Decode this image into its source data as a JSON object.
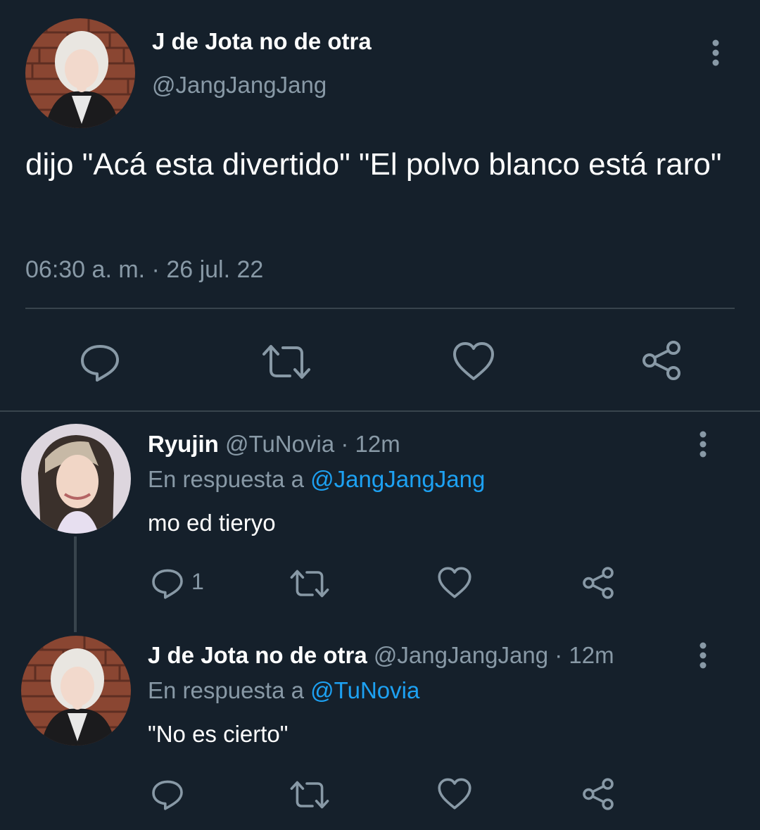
{
  "main_tweet": {
    "display_name": "J de Jota no de otra",
    "handle": "@JangJangJang",
    "text": "dijo \"Acá esta divertido\" \"El polvo blanco está raro\"",
    "timestamp": "06:30 a. m. · 26 jul. 22",
    "more_icon": "more-vertical-icon",
    "actions": [
      "reply-icon",
      "retweet-icon",
      "like-icon",
      "share-icon"
    ]
  },
  "replies": [
    {
      "display_name": "Ryujin",
      "handle": "@TuNovia",
      "time": "· 12m",
      "reply_prefix": "En respuesta a",
      "reply_to": "@JangJangJang",
      "text": "mo ed tieryo",
      "reply_count": "1"
    },
    {
      "display_name": "J de Jota no de otra",
      "handle": "@JangJangJang",
      "time": "· 12m",
      "reply_prefix": "En respuesta a",
      "reply_to": "@TuNovia",
      "text": "\"No es cierto\"",
      "reply_count": ""
    }
  ],
  "colors": {
    "background": "#15202b",
    "muted": "#8899a6",
    "link": "#1da1f2",
    "divider": "#38444d"
  }
}
